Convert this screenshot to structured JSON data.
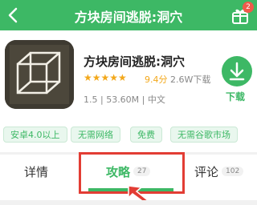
{
  "header": {
    "title": "方块房间逃脱:洞穴",
    "gift_badge": "2"
  },
  "app": {
    "name": "方块房间逃脱:洞穴",
    "stars": "★★★★★",
    "rating": "9.4分",
    "downloads": "2.6W下载",
    "meta": "1.5 | 53.60M | 中文",
    "download_label": "下载"
  },
  "tags": [
    "安卓4.0以上",
    "无需网络",
    "免费",
    "无需谷歌市场"
  ],
  "tabs": [
    {
      "label": "详情",
      "count": ""
    },
    {
      "label": "攻略",
      "count": "27"
    },
    {
      "label": "评论",
      "count": "102"
    }
  ],
  "colors": {
    "accent": "#3db865",
    "highlight": "#e23d34",
    "star": "#f3a81b"
  },
  "icons": [
    "back-arrow-icon",
    "gift-icon",
    "download-icon",
    "pointer-arrow-icon"
  ]
}
